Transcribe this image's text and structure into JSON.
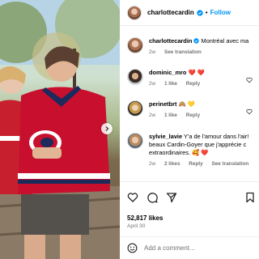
{
  "post": {
    "username": "charlottecardin",
    "separator": "•",
    "follow_label": "Follow",
    "caption": "Montréal avec ma",
    "caption_age": "2w",
    "see_translation": "See translation"
  },
  "comments": [
    {
      "username": "dominic_mro",
      "text": "",
      "emoji": "❤️ ❤️",
      "age": "2w",
      "likes": "1 like",
      "reply": "Reply"
    },
    {
      "username": "perinetbrt",
      "text": "",
      "emoji": "🙈 💛",
      "age": "2w",
      "likes": "1 like",
      "reply": "Reply"
    },
    {
      "username": "sylvie_lavie",
      "text": "Y'a de l'amour dans l'air!",
      "text2": "beaux Cardin-Goyer que j'apprécie c",
      "text3": "extraordinaires. 🥰 ❤️",
      "age": "2w",
      "likes": "2 likes",
      "reply": "Reply",
      "see_translation": "See translation"
    }
  ],
  "stats": {
    "likes": "52,817 likes",
    "date": "April 30"
  },
  "add_comment": {
    "placeholder": "Add a comment..."
  },
  "icons": [
    "verified-icon",
    "heart-icon",
    "comment-icon",
    "share-icon",
    "bookmark-icon",
    "emoji-icon",
    "chevron-right-icon"
  ],
  "colors": {
    "accent": "#0095f6",
    "muted": "#737373",
    "heart": "#ed4956"
  }
}
